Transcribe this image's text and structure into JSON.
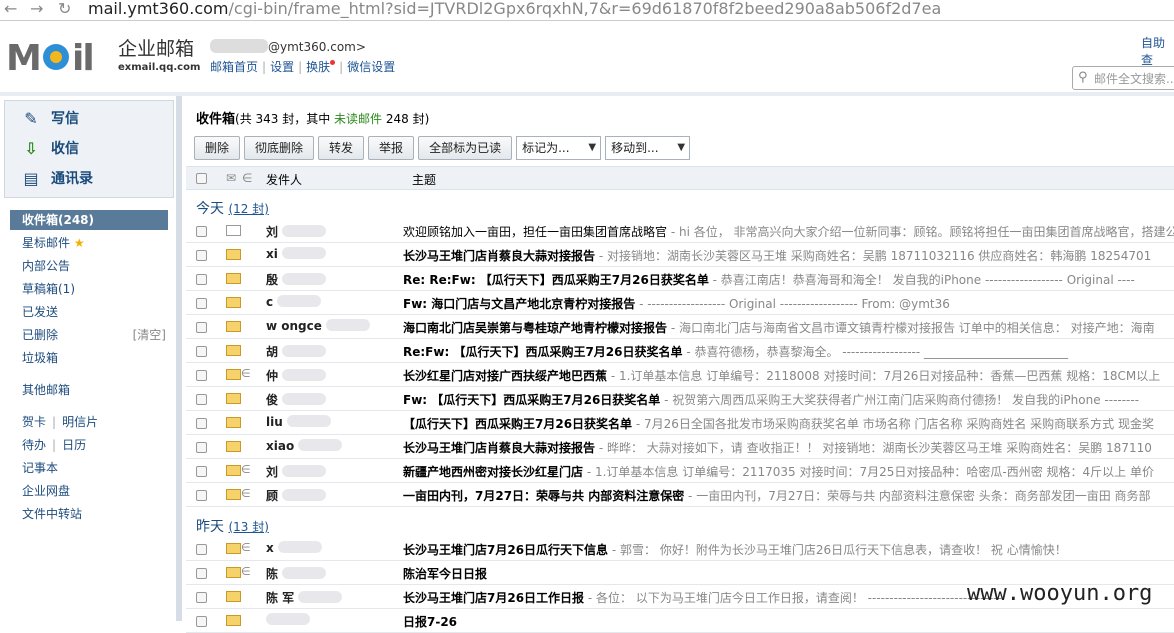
{
  "browser": {
    "url_host": "mail.ymt360.com",
    "url_rest": "/cgi-bin/frame_html?sid=JTVRDl2Gpx6rqxhN,7&r=69d61870f8f2beed290a8ab506f2d7ea"
  },
  "header": {
    "logo_text": "MOil",
    "brand": "企业邮箱",
    "brand_sub": "exmail.qq.com",
    "account_domain": "@ymt360.com>",
    "links": [
      "邮箱首页",
      "设置",
      "换肤",
      "微信设置"
    ],
    "helper": "自助查",
    "search_placeholder": "邮件全文搜索..."
  },
  "sidebar": {
    "quick": [
      {
        "label": "写信",
        "icon": "pencil-icon"
      },
      {
        "label": "收信",
        "icon": "download-icon"
      },
      {
        "label": "通讯录",
        "icon": "contacts-icon"
      }
    ],
    "folders": [
      {
        "label": "收件箱(248)"
      },
      {
        "label": "星标邮件"
      },
      {
        "label": "内部公告"
      },
      {
        "label": "草稿箱(1)"
      },
      {
        "label": "已发送"
      },
      {
        "label": "已删除",
        "extra": "[清空]"
      },
      {
        "label": "垃圾箱"
      }
    ],
    "other_label": "其他邮箱",
    "tools": [
      {
        "a": "贺卡",
        "b": "明信片"
      },
      {
        "a": "待办",
        "b": "日历"
      }
    ],
    "more": [
      "记事本",
      "企业网盘",
      "文件中转站"
    ]
  },
  "main": {
    "title": "收件箱",
    "summary_pre": "(共 343 封，其中 ",
    "unread_label": "未读邮件",
    "summary_post": " 248 封)",
    "buttons": [
      "删除",
      "彻底删除",
      "转发",
      "举报",
      "全部标为已读"
    ],
    "selects": [
      "标记为...",
      "移动到..."
    ],
    "col_from": "发件人",
    "col_subject": "主题",
    "groups": [
      {
        "label": "今天",
        "count": "(12 封)"
      },
      {
        "label": "昨天",
        "count": "(13 封)"
      }
    ],
    "today": [
      {
        "from": "刘",
        "subject": "欢迎顾铭加入一亩田，担任一亩田集团首席战略官",
        "preview": " - hi 各位，  非常高兴向大家介绍一位新同事：顾铭。顾铭将担任一亩田集团首席战略官，搭建公",
        "read": true,
        "attach": false
      },
      {
        "from": "xi",
        "subject": "长沙马王堆门店肖蔡良大蒜对接报告",
        "preview": " - 对接销地：湖南长沙芙蓉区马王堆 采购商姓名：吴鹏 18711032116 供应商姓名：韩海鹏 18254701",
        "read": false,
        "attach": false
      },
      {
        "from": "殷",
        "subject": "Re: Re:Fw: 【瓜行天下】西瓜采购王7月26日获奖名单",
        "preview": " - 恭喜江南店！恭喜海哥和海全！ 发自我的iPhone ------------------ Original ----",
        "read": false,
        "attach": false
      },
      {
        "from": "c",
        "subject": "Fw: 海口门店与文昌产地北京青柠对接报告",
        "preview": " - ------------------ Original ------------------ From:                    @ymt36",
        "read": false,
        "attach": false
      },
      {
        "from": "w   ongce",
        "subject": "海口南北门店吴崇第与粤桂琼产地青柠檬对接报告",
        "preview": " - 海口南北门店与海南省文昌市谭文镇青柠檬对接报告 订单中的相关信息：  对接产地：海南",
        "read": false,
        "attach": false
      },
      {
        "from": "胡",
        "subject": "Re:Fw: 【瓜行天下】西瓜采购王7月26日获奖名单",
        "preview": " - 恭喜符德杨，恭喜黎海全。  ------------------  ________________________",
        "read": false,
        "attach": false
      },
      {
        "from": "仲",
        "subject": "长沙红星门店对接广西扶绥产地巴西蕉",
        "preview": " - 1.订单基本信息 订单编号：2118008 对接时间：7月26日对接品种：香蕉—巴西蕉 规格：18CM以上",
        "read": false,
        "attach": true
      },
      {
        "from": "  俊",
        "subject": "Fw: 【瓜行天下】西瓜采购王7月26日获奖名单",
        "preview": " - 祝贺第六周西瓜采购王大奖获得者广州江南门店采购商付德扬！ 发自我的iPhone --------",
        "read": false,
        "attach": false
      },
      {
        "from": "liu",
        "subject": "【瓜行天下】西瓜采购王7月26日获奖名单",
        "preview": " - 7月26日全国各批发市场采购商获奖名单 市场名称 门店名称 采购商姓名 采购商联系方式 现金奖",
        "read": false,
        "attach": false
      },
      {
        "from": "xiao",
        "subject": "长沙马王堆门店肖蔡良大蒜对接报告",
        "preview": " - 晔晔：  大蒜对接如下，请 查收指正！！  对接销地：湖南长沙芙蓉区马王堆 采购商姓名：吴鹏 187110",
        "read": false,
        "attach": false
      },
      {
        "from": "刘",
        "subject": "新疆产地西州密对接长沙红星门店",
        "preview": " - 1.订单基本信息 订单编号：2117035 对接时间：7月25日对接品种：哈密瓜-西州密 规格：4斤以上 单价",
        "read": false,
        "attach": true
      },
      {
        "from": "顾",
        "subject": "一亩田内刊，7月27日：荣辱与共 内部资料注意保密",
        "preview": " - 一亩田内刊，7月27日：荣辱与共 内部资料注意保密 头条：商务部发团一亩田 商务部",
        "read": false,
        "attach": true
      }
    ],
    "yesterday": [
      {
        "from": "x",
        "subject": "长沙马王堆门店7月26日瓜行天下信息",
        "preview": " - 郭雪：  你好！附件为长沙马王堆门店26日瓜行天下信息表，请查收！ 祝 心情愉快！",
        "read": false,
        "attach": true
      },
      {
        "from": "陈",
        "subject": "陈治军今日日报",
        "preview": "",
        "read": false,
        "attach": true
      },
      {
        "from": "陈  军",
        "subject": "长沙马王堆门店7月26日工作日报",
        "preview": " - 各位：  以下为马王堆门店今日工作日报，请查阅！ -------------------------------",
        "read": false,
        "attach": false
      },
      {
        "from": "",
        "subject": "日报7-26",
        "preview": "",
        "read": false,
        "attach": false
      }
    ]
  },
  "watermark": "www.wooyun.org"
}
